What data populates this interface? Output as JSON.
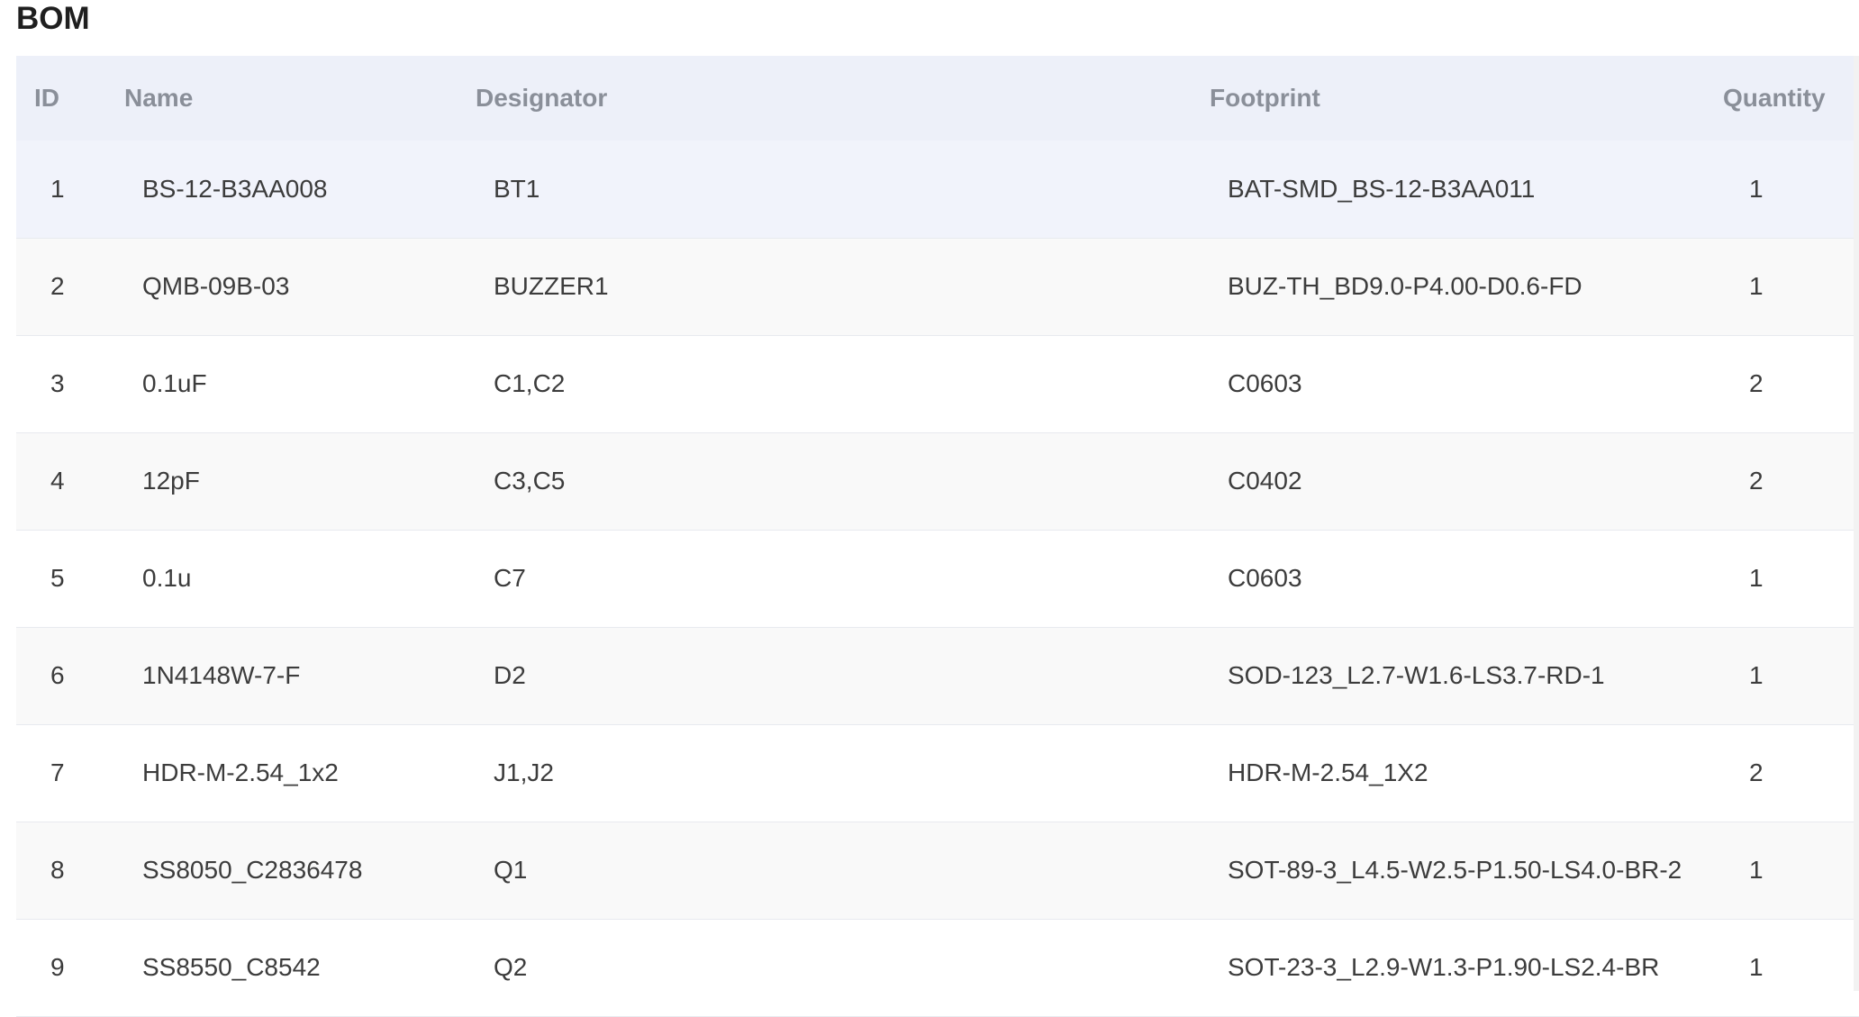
{
  "page": {
    "title": "BOM"
  },
  "table": {
    "headers": {
      "id": "ID",
      "name": "Name",
      "designator": "Designator",
      "footprint": "Footprint",
      "quantity": "Quantity"
    },
    "rows": [
      {
        "id": "1",
        "name": "BS-12-B3AA008",
        "designator": "BT1",
        "footprint": "BAT-SMD_BS-12-B3AA011",
        "quantity": "1"
      },
      {
        "id": "2",
        "name": "QMB-09B-03",
        "designator": "BUZZER1",
        "footprint": "BUZ-TH_BD9.0-P4.00-D0.6-FD",
        "quantity": "1"
      },
      {
        "id": "3",
        "name": "0.1uF",
        "designator": "C1,C2",
        "footprint": "C0603",
        "quantity": "2"
      },
      {
        "id": "4",
        "name": "12pF",
        "designator": "C3,C5",
        "footprint": "C0402",
        "quantity": "2"
      },
      {
        "id": "5",
        "name": "0.1u",
        "designator": "C7",
        "footprint": "C0603",
        "quantity": "1"
      },
      {
        "id": "6",
        "name": "1N4148W-7-F",
        "designator": "D2",
        "footprint": "SOD-123_L2.7-W1.6-LS3.7-RD-1",
        "quantity": "1"
      },
      {
        "id": "7",
        "name": "HDR-M-2.54_1x2",
        "designator": "J1,J2",
        "footprint": "HDR-M-2.54_1X2",
        "quantity": "2"
      },
      {
        "id": "8",
        "name": "SS8050_C2836478",
        "designator": "Q1",
        "footprint": "SOT-89-3_L4.5-W2.5-P1.50-LS4.0-BR-2",
        "quantity": "1"
      },
      {
        "id": "9",
        "name": "SS8550_C8542",
        "designator": "Q2",
        "footprint": "SOT-23-3_L2.9-W1.3-P1.90-LS2.4-BR",
        "quantity": "1"
      }
    ]
  },
  "colors": {
    "header_background": "#edf0f9",
    "header_text": "#8a8f99",
    "row_highlight": "#f1f3fb",
    "row_alt": "#f9f9f9",
    "text": "#3c3c3c"
  }
}
